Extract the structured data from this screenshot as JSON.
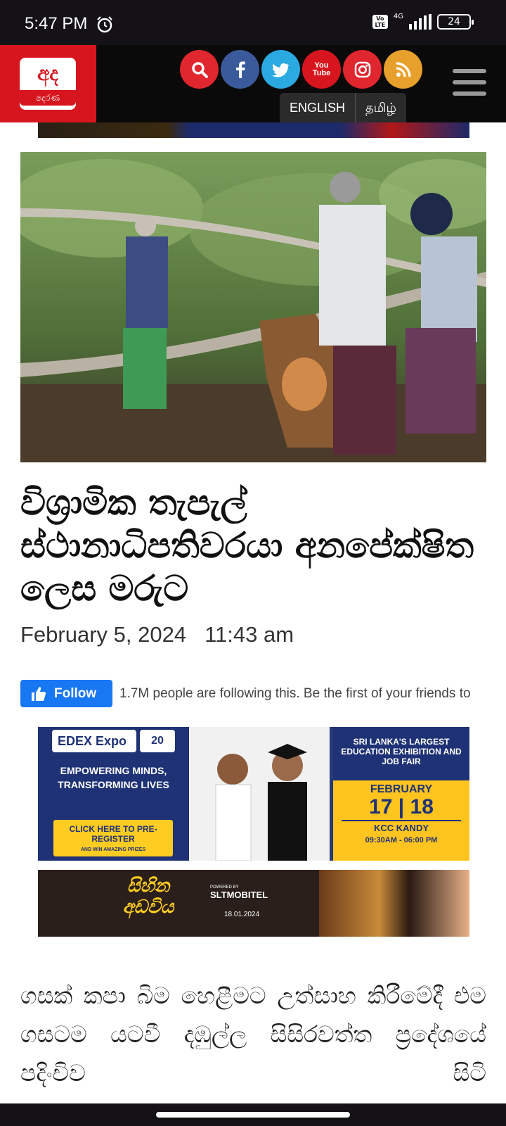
{
  "status_bar": {
    "time": "5:47 PM",
    "volte": "Vo LTE",
    "network": "4G",
    "battery": "24"
  },
  "header": {
    "logo_top": "අද",
    "logo_bottom": "දෙරණ",
    "social_icons": [
      {
        "name": "search-icon",
        "color": "#e0262e"
      },
      {
        "name": "facebook-icon",
        "color": "#3a5a9b"
      },
      {
        "name": "twitter-icon",
        "color": "#2ba9e1"
      },
      {
        "name": "youtube-icon",
        "color": "#d7151e"
      },
      {
        "name": "instagram-icon",
        "color": "#e0262e"
      },
      {
        "name": "rss-icon",
        "color": "#e8a02c"
      }
    ],
    "youtube_label": "You Tube",
    "lang_english": "ENGLISH",
    "lang_tamil": "தமிழ்"
  },
  "article": {
    "title": "විශ්‍රාමික තැපැල් ස්ථානාධිපතිවරයා අනපේක්ෂිත ලෙස මරුට",
    "date": "February 5, 2024",
    "time": "11:43 am",
    "body": "ගසක් කපා බිම හෙළීමට උත්සාහ කිරීමේදී එම ගසටම යටවී දඹුල්ල සිසිරවත්ත ප්‍රදේශයේ පදිංචිව සිටි"
  },
  "facebook": {
    "follow_label": "Follow",
    "follow_text": "1.7M people are following this. Be the first of your friends to"
  },
  "ad_edex": {
    "logo": "EDEX Expo",
    "badge": "20",
    "slogan": "EMPOWERING MINDS, TRANSFORMING LIVES",
    "cta": "CLICK HERE TO PRE-REGISTER",
    "cta_small": "AND WIN AMAZING PRIZES",
    "headline": "SRI LANKA'S LARGEST EDUCATION EXHIBITION AND JOB FAIR",
    "month": "FEBRUARY",
    "days": "17 | 18",
    "venue": "KCC KANDY",
    "hours": "09:30AM - 06:00 PM"
  },
  "ad_show": {
    "title": "සිහින අඩවිය",
    "sponsor": "SLTMOBITEL",
    "sponsor_small": "POWERED BY",
    "date": "18.01.2024"
  }
}
